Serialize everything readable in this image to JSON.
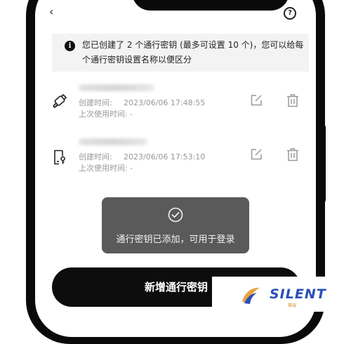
{
  "info_banner": {
    "icon": "info-icon",
    "line1": "您已创建了 2 个通行密钥 (最多可设置 10 个)，您可以给每",
    "line2": "个通行密钥设置名称以便区分"
  },
  "passkeys": [
    {
      "icon": "usb-key-icon",
      "created_label": "创建时间:",
      "created_value": "2023/06/06 17:48:55",
      "last_used_label": "上次使用时间:",
      "last_used_value": "-"
    },
    {
      "icon": "device-key-icon",
      "created_label": "创建时间:",
      "created_value": "2023/06/06 17:53:10",
      "last_used_label": "上次使用时间:",
      "last_used_value": "-"
    }
  ],
  "toast": {
    "icon": "check-circle-icon",
    "message": "通行密钥已添加，可用于登录"
  },
  "primary_button": {
    "label": "新增通行密钥"
  },
  "watermark": {
    "text": "SILENT",
    "subtext": "赛瑞"
  },
  "colors": {
    "button_bg": "#0d0d0d",
    "toast_bg": "#5a5a5a",
    "banner_bg": "#f3f3f3",
    "watermark_blue": "#2a4fb8",
    "watermark_orange": "#e8a23a"
  }
}
